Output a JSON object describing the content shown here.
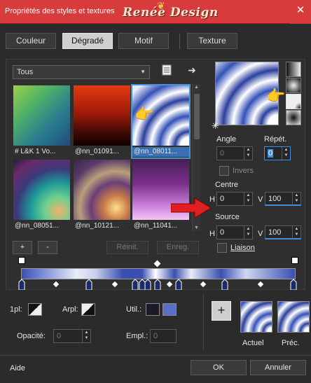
{
  "window": {
    "title": "Propriétés des styles et textures",
    "watermark": "Renée Design",
    "close": "✕"
  },
  "tabs": [
    {
      "label": "Couleur"
    },
    {
      "label": "Dégradé"
    },
    {
      "label": "Motif"
    },
    {
      "label": "Texture"
    }
  ],
  "library": {
    "category": "Tous",
    "thumbnails": [
      {
        "label": "# L&K 1 Vo..."
      },
      {
        "label": "@nn_01091..."
      },
      {
        "label": "@nn_08011..."
      },
      {
        "label": "@nn_08051..."
      },
      {
        "label": "@nn_10121..."
      },
      {
        "label": "@nn_11041..."
      }
    ],
    "add": "+",
    "remove": "-",
    "reset": "Réinit.",
    "save": "Enreg."
  },
  "gradient_settings": {
    "angle_label": "Angle",
    "angle_value": "0",
    "repeat_label": "Répét.",
    "repeat_value": "0",
    "invert_label": "Invers",
    "center_label": "Centre",
    "center_h_label": "H",
    "center_h": "0",
    "center_v_label": "V",
    "center_v": "100",
    "source_label": "Source",
    "source_h_label": "H",
    "source_h": "0",
    "source_v_label": "V",
    "source_v": "100",
    "link_label": "Liaison"
  },
  "stop_controls": {
    "position_label": "1pl:",
    "arpl_label": "Arpl:",
    "util_label": "Util.:",
    "opacity_label": "Opacité:",
    "opacity_value": "0",
    "empl_label": "Empl.:",
    "empl_value": "0",
    "user_color": "#5a6fc8"
  },
  "previews": {
    "current_label": "Actuel",
    "previous_label": "Préc."
  },
  "footer": {
    "help": "Aide",
    "ok": "OK",
    "cancel": "Annuler"
  },
  "colors": {
    "title_bar": "#d83b3b",
    "accent": "#4a90d9",
    "pointer_arrow": "#e02020"
  }
}
